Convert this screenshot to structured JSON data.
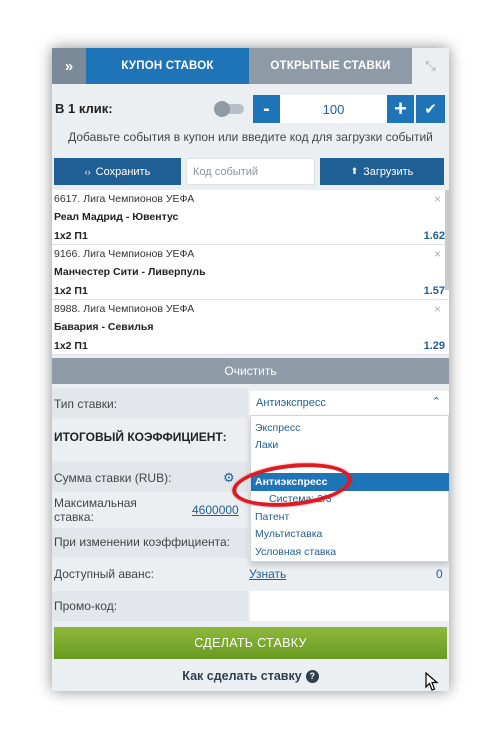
{
  "tabs": {
    "expand_icon": "»",
    "coupon": "КУПОН СТАВОК",
    "open_bets": "ОТКРЫТЫЕ СТАВКИ",
    "collapse_icon": "⤡"
  },
  "one_click": {
    "label": "В 1 клик:",
    "minus": "-",
    "value": "100",
    "plus": "+",
    "ok": "✔"
  },
  "hint": "Добавьте события в купон или введите код для загрузки событий",
  "actions": {
    "save_icon": "‹›",
    "save": "Сохранить",
    "code_placeholder": "Код событий",
    "load_icon": "⬆",
    "load": "Загрузить"
  },
  "events": [
    {
      "league": "6617. Лига Чемпионов УЕФА",
      "teams": "Реал Мадрид - Ювентус",
      "market": "1x2 П1",
      "odd": "1.62",
      "close": "×"
    },
    {
      "league": "9166. Лига Чемпионов УЕФА",
      "teams": "Манчестер Сити - Ливерпуль",
      "market": "1x2 П1",
      "odd": "1.57",
      "close": "×"
    },
    {
      "league": "8988. Лига Чемпионов УЕФА",
      "teams": "Бавария - Севилья",
      "market": "1x2 П1",
      "odd": "1.29",
      "close": "×"
    }
  ],
  "clear": "Очистить",
  "bet_type": {
    "label": "Тип ставки:",
    "selected": "Антиэкспресс",
    "chevron": "⌃",
    "options": [
      "Экспресс",
      "Лаки",
      "Антиэкспресс",
      "Система: 2/3",
      "Патент",
      "Мультиставка",
      "Условная ставка"
    ]
  },
  "total_coef_label": "ИТОГОВЫЙ КОЭФФИЦИЕНТ:",
  "stake_sum_label": "Сумма ставки (RUB):",
  "gear_icon": "⚙",
  "max_stake": {
    "label_line1": "Максимальная",
    "label_line2": "ставка:",
    "value": "4600000"
  },
  "coef_change_label": "При изменении коэффициента:",
  "advance": {
    "label": "Доступный аванс:",
    "link": "Узнать",
    "value": "0"
  },
  "promo_label": "Промо-код:",
  "place_bet": "СДЕЛАТЬ СТАВКУ",
  "how_to": "Как сделать ставку",
  "help_icon": "?",
  "colors": {
    "accent": "#1f73b7",
    "green": "#7aa82e",
    "highlight": "#e01a22"
  }
}
